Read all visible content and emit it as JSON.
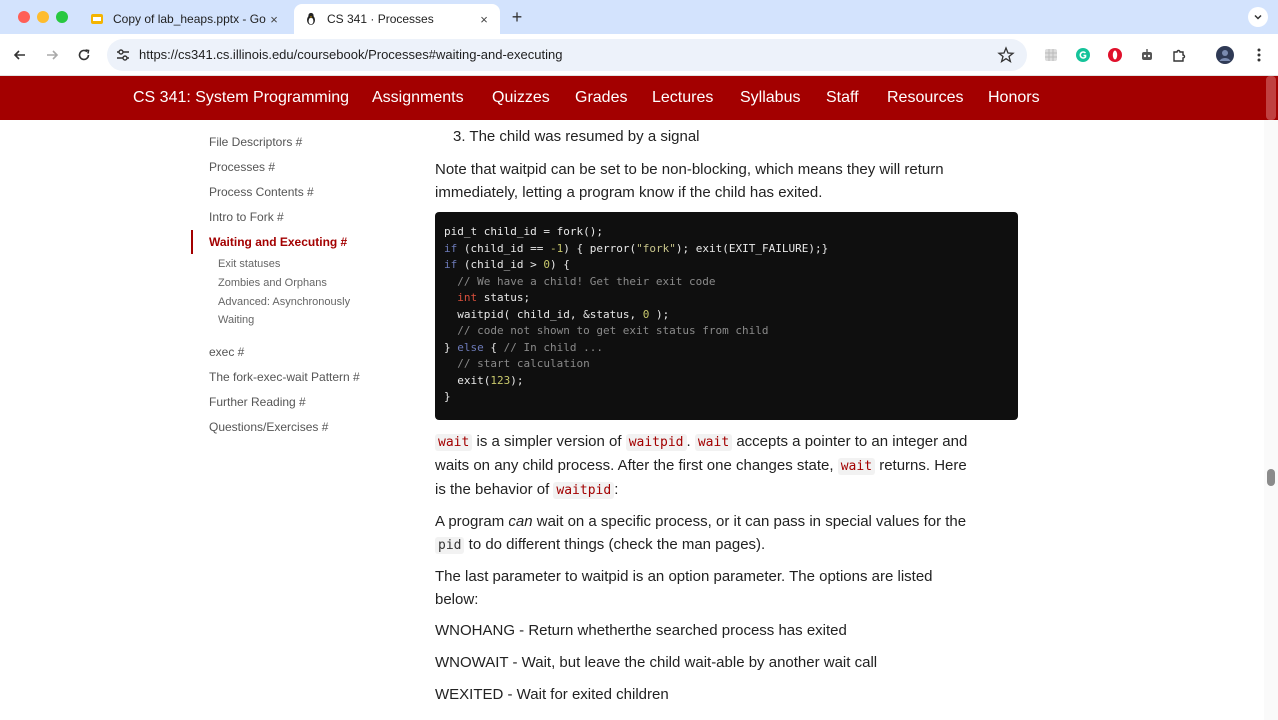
{
  "browser": {
    "tabs": [
      {
        "title": "Copy of lab_heaps.pptx - Goo",
        "close": "×"
      },
      {
        "title": "CS 341 · Processes",
        "close": "×"
      }
    ],
    "new_tab": "+",
    "url": "https://cs341.cs.illinois.edu/coursebook/Processes#waiting-and-executing",
    "colors": {
      "tabstrip": "#d3e3fd",
      "omnibox": "#edf2fa"
    }
  },
  "site_nav": {
    "brand": "CS 341: System Programming",
    "links": [
      "Assignments",
      "Quizzes",
      "Grades",
      "Lectures",
      "Syllabus",
      "Staff",
      "Resources",
      "Honors"
    ],
    "color": "#a30000"
  },
  "sidebar": {
    "items_before": [
      "File Descriptors #",
      "Processes #",
      "Process Contents #",
      "Intro to Fork #"
    ],
    "active": "Waiting and Executing #",
    "subitems": [
      "Exit statuses",
      "Zombies and Orphans",
      "Advanced: Asynchronously",
      "Waiting"
    ],
    "items_after": [
      "exec #",
      "The fork-exec-wait Pattern #",
      "Further Reading #",
      "Questions/Exercises #"
    ]
  },
  "content": {
    "list_item_3": "3. The child was resumed by a signal",
    "p1_line1": "Note that waitpid can be set to be non-blocking, which means they will return",
    "p1_line2": "immediately, letting a program know if the child has exited.",
    "code": {
      "l1_a": "pid_t child_id = fork",
      "l1_b": "();",
      "l2_if": "if",
      "l2_a": " (",
      "l2_b": "child_id == ",
      "l2_num": "-1",
      "l2_c": ") { ",
      "l2_d": "perror",
      "l2_e": "(",
      "l2_str": "\"fork\"",
      "l2_f": "); ",
      "l2_g": "exit",
      "l2_h": "(",
      "l2_i": "EXIT_FAILURE",
      "l2_j": ");}",
      "l3_if": "if",
      "l3_a": " (",
      "l3_b": "child_id > ",
      "l3_num": "0",
      "l3_c": ") {",
      "l4": "  // We have a child! Get their exit code",
      "l5_int": "int",
      "l5_b": " status",
      "l5_c": ";",
      "l6_a": "waitpid",
      "l6_b": "( ",
      "l6_c": "child_id",
      "l6_d": ", &",
      "l6_e": "status",
      "l6_f": ", ",
      "l6_num": "0",
      "l6_g": " );",
      "l7": "  // code not shown to get exit status from child",
      "l8_a": "} ",
      "l8_else": "else",
      "l8_b": " { ",
      "l8_cm": "// In child ...",
      "l9": "  // start calculation",
      "l10_a": "exit",
      "l10_b": "(",
      "l10_num": "123",
      "l10_c": ");",
      "l11": "}"
    },
    "p2": {
      "c1": "wait",
      "t1": " is a simpler version of ",
      "c2": "waitpid",
      "t2": ". ",
      "c3": "wait",
      "t3": " accepts a pointer to an integer and",
      "line2a": "waits on any child process. After the first one changes state, ",
      "c4": "wait",
      "line2b": " returns. Here",
      "line3a": "is the behavior of ",
      "c5": "waitpid",
      "line3b": ":"
    },
    "p3": {
      "a": "A program ",
      "em": "can",
      "b": " wait on a specific process, or it can pass in special values for the",
      "code": "pid",
      "c": " to do different things (check the man pages)."
    },
    "p4_line1": "The last parameter to waitpid is an option parameter. The options are listed",
    "p4_line2": "below:",
    "opt1": "WNOHANG - Return whetherthe searched process has exited",
    "opt2": "WNOWAIT - Wait, but leave the child wait-able by another wait call",
    "opt3": "WEXITED - Wait for exited children"
  }
}
